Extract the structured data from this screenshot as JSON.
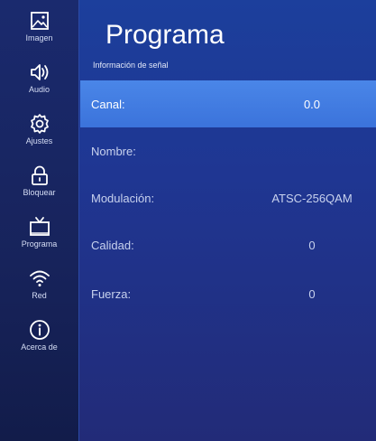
{
  "sidebar": {
    "items": [
      {
        "label": "Imagen",
        "icon": "picture-icon"
      },
      {
        "label": "Audio",
        "icon": "speaker-icon"
      },
      {
        "label": "Ajustes",
        "icon": "gear-icon"
      },
      {
        "label": "Bloquear",
        "icon": "lock-icon"
      },
      {
        "label": "Programa",
        "icon": "tv-icon"
      },
      {
        "label": "Red",
        "icon": "wifi-icon"
      },
      {
        "label": "Acerca de",
        "icon": "info-icon"
      }
    ]
  },
  "header": {
    "title": "Programa",
    "subtitle": "Información de señal"
  },
  "rows": [
    {
      "label": "Canal:",
      "value": "0.0"
    },
    {
      "label": "Nombre:",
      "value": ""
    },
    {
      "label": "Modulación:",
      "value": "ATSC-256QAM"
    },
    {
      "label": "Calidad:",
      "value": "0"
    },
    {
      "label": "Fuerza:",
      "value": "0"
    }
  ],
  "colors": {
    "selected_row": "#3b73db",
    "sidebar_bg": "#17235b",
    "main_bg": "#1f3692"
  }
}
